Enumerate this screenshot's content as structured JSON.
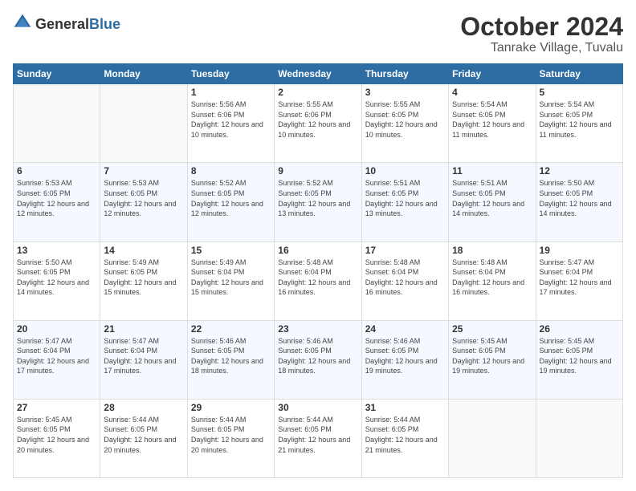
{
  "header": {
    "logo_general": "General",
    "logo_blue": "Blue",
    "month": "October 2024",
    "location": "Tanrake Village, Tuvalu"
  },
  "weekdays": [
    "Sunday",
    "Monday",
    "Tuesday",
    "Wednesday",
    "Thursday",
    "Friday",
    "Saturday"
  ],
  "weeks": [
    [
      {
        "day": "",
        "sunrise": "",
        "sunset": "",
        "daylight": ""
      },
      {
        "day": "",
        "sunrise": "",
        "sunset": "",
        "daylight": ""
      },
      {
        "day": "1",
        "sunrise": "Sunrise: 5:56 AM",
        "sunset": "Sunset: 6:06 PM",
        "daylight": "Daylight: 12 hours and 10 minutes."
      },
      {
        "day": "2",
        "sunrise": "Sunrise: 5:55 AM",
        "sunset": "Sunset: 6:06 PM",
        "daylight": "Daylight: 12 hours and 10 minutes."
      },
      {
        "day": "3",
        "sunrise": "Sunrise: 5:55 AM",
        "sunset": "Sunset: 6:05 PM",
        "daylight": "Daylight: 12 hours and 10 minutes."
      },
      {
        "day": "4",
        "sunrise": "Sunrise: 5:54 AM",
        "sunset": "Sunset: 6:05 PM",
        "daylight": "Daylight: 12 hours and 11 minutes."
      },
      {
        "day": "5",
        "sunrise": "Sunrise: 5:54 AM",
        "sunset": "Sunset: 6:05 PM",
        "daylight": "Daylight: 12 hours and 11 minutes."
      }
    ],
    [
      {
        "day": "6",
        "sunrise": "Sunrise: 5:53 AM",
        "sunset": "Sunset: 6:05 PM",
        "daylight": "Daylight: 12 hours and 12 minutes."
      },
      {
        "day": "7",
        "sunrise": "Sunrise: 5:53 AM",
        "sunset": "Sunset: 6:05 PM",
        "daylight": "Daylight: 12 hours and 12 minutes."
      },
      {
        "day": "8",
        "sunrise": "Sunrise: 5:52 AM",
        "sunset": "Sunset: 6:05 PM",
        "daylight": "Daylight: 12 hours and 12 minutes."
      },
      {
        "day": "9",
        "sunrise": "Sunrise: 5:52 AM",
        "sunset": "Sunset: 6:05 PM",
        "daylight": "Daylight: 12 hours and 13 minutes."
      },
      {
        "day": "10",
        "sunrise": "Sunrise: 5:51 AM",
        "sunset": "Sunset: 6:05 PM",
        "daylight": "Daylight: 12 hours and 13 minutes."
      },
      {
        "day": "11",
        "sunrise": "Sunrise: 5:51 AM",
        "sunset": "Sunset: 6:05 PM",
        "daylight": "Daylight: 12 hours and 14 minutes."
      },
      {
        "day": "12",
        "sunrise": "Sunrise: 5:50 AM",
        "sunset": "Sunset: 6:05 PM",
        "daylight": "Daylight: 12 hours and 14 minutes."
      }
    ],
    [
      {
        "day": "13",
        "sunrise": "Sunrise: 5:50 AM",
        "sunset": "Sunset: 6:05 PM",
        "daylight": "Daylight: 12 hours and 14 minutes."
      },
      {
        "day": "14",
        "sunrise": "Sunrise: 5:49 AM",
        "sunset": "Sunset: 6:05 PM",
        "daylight": "Daylight: 12 hours and 15 minutes."
      },
      {
        "day": "15",
        "sunrise": "Sunrise: 5:49 AM",
        "sunset": "Sunset: 6:04 PM",
        "daylight": "Daylight: 12 hours and 15 minutes."
      },
      {
        "day": "16",
        "sunrise": "Sunrise: 5:48 AM",
        "sunset": "Sunset: 6:04 PM",
        "daylight": "Daylight: 12 hours and 16 minutes."
      },
      {
        "day": "17",
        "sunrise": "Sunrise: 5:48 AM",
        "sunset": "Sunset: 6:04 PM",
        "daylight": "Daylight: 12 hours and 16 minutes."
      },
      {
        "day": "18",
        "sunrise": "Sunrise: 5:48 AM",
        "sunset": "Sunset: 6:04 PM",
        "daylight": "Daylight: 12 hours and 16 minutes."
      },
      {
        "day": "19",
        "sunrise": "Sunrise: 5:47 AM",
        "sunset": "Sunset: 6:04 PM",
        "daylight": "Daylight: 12 hours and 17 minutes."
      }
    ],
    [
      {
        "day": "20",
        "sunrise": "Sunrise: 5:47 AM",
        "sunset": "Sunset: 6:04 PM",
        "daylight": "Daylight: 12 hours and 17 minutes."
      },
      {
        "day": "21",
        "sunrise": "Sunrise: 5:47 AM",
        "sunset": "Sunset: 6:04 PM",
        "daylight": "Daylight: 12 hours and 17 minutes."
      },
      {
        "day": "22",
        "sunrise": "Sunrise: 5:46 AM",
        "sunset": "Sunset: 6:05 PM",
        "daylight": "Daylight: 12 hours and 18 minutes."
      },
      {
        "day": "23",
        "sunrise": "Sunrise: 5:46 AM",
        "sunset": "Sunset: 6:05 PM",
        "daylight": "Daylight: 12 hours and 18 minutes."
      },
      {
        "day": "24",
        "sunrise": "Sunrise: 5:46 AM",
        "sunset": "Sunset: 6:05 PM",
        "daylight": "Daylight: 12 hours and 19 minutes."
      },
      {
        "day": "25",
        "sunrise": "Sunrise: 5:45 AM",
        "sunset": "Sunset: 6:05 PM",
        "daylight": "Daylight: 12 hours and 19 minutes."
      },
      {
        "day": "26",
        "sunrise": "Sunrise: 5:45 AM",
        "sunset": "Sunset: 6:05 PM",
        "daylight": "Daylight: 12 hours and 19 minutes."
      }
    ],
    [
      {
        "day": "27",
        "sunrise": "Sunrise: 5:45 AM",
        "sunset": "Sunset: 6:05 PM",
        "daylight": "Daylight: 12 hours and 20 minutes."
      },
      {
        "day": "28",
        "sunrise": "Sunrise: 5:44 AM",
        "sunset": "Sunset: 6:05 PM",
        "daylight": "Daylight: 12 hours and 20 minutes."
      },
      {
        "day": "29",
        "sunrise": "Sunrise: 5:44 AM",
        "sunset": "Sunset: 6:05 PM",
        "daylight": "Daylight: 12 hours and 20 minutes."
      },
      {
        "day": "30",
        "sunrise": "Sunrise: 5:44 AM",
        "sunset": "Sunset: 6:05 PM",
        "daylight": "Daylight: 12 hours and 21 minutes."
      },
      {
        "day": "31",
        "sunrise": "Sunrise: 5:44 AM",
        "sunset": "Sunset: 6:05 PM",
        "daylight": "Daylight: 12 hours and 21 minutes."
      },
      {
        "day": "",
        "sunrise": "",
        "sunset": "",
        "daylight": ""
      },
      {
        "day": "",
        "sunrise": "",
        "sunset": "",
        "daylight": ""
      }
    ]
  ]
}
